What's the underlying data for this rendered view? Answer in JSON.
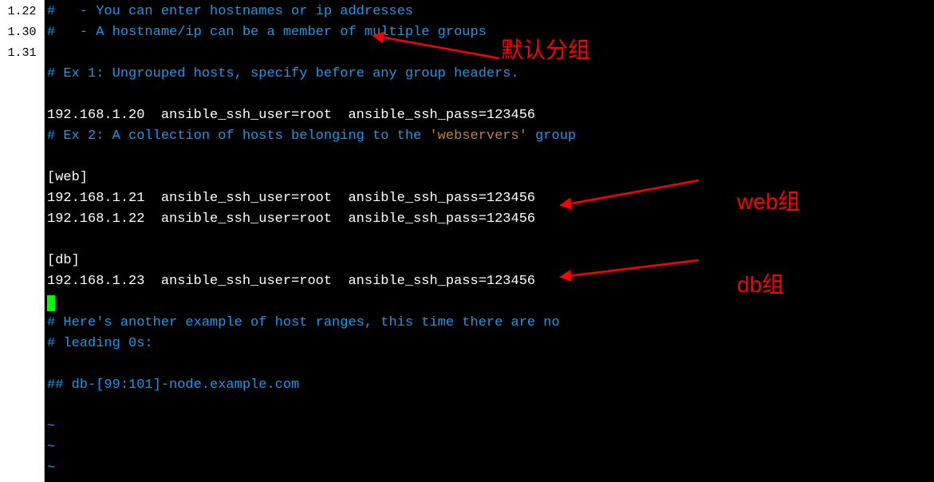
{
  "sidebar": {
    "items": [
      "1.22",
      "",
      "1.30",
      "1.31"
    ]
  },
  "terminal": {
    "lines": [
      {
        "type": "comment",
        "text": "#   - You can enter hostnames or ip addresses"
      },
      {
        "type": "comment",
        "text": "#   - A hostname/ip can be a member of multiple groups"
      },
      {
        "type": "blank",
        "text": ""
      },
      {
        "type": "comment",
        "text": "# Ex 1: Ungrouped hosts, specify before any group headers."
      },
      {
        "type": "blank",
        "text": ""
      },
      {
        "type": "plain",
        "text": "192.168.1.20  ansible_ssh_user=root  ansible_ssh_pass=123456"
      },
      {
        "type": "comment_mixed",
        "text": "# Ex 2: A collection of hosts belonging to the 'webservers' group"
      },
      {
        "type": "blank",
        "text": ""
      },
      {
        "type": "plain",
        "text": "[web]"
      },
      {
        "type": "plain",
        "text": "192.168.1.21  ansible_ssh_user=root  ansible_ssh_pass=123456"
      },
      {
        "type": "plain",
        "text": "192.168.1.22  ansible_ssh_user=root  ansible_ssh_pass=123456"
      },
      {
        "type": "blank",
        "text": ""
      },
      {
        "type": "plain",
        "text": "[db]"
      },
      {
        "type": "plain",
        "text": "192.168.1.23  ansible_ssh_user=root  ansible_ssh_pass=123456"
      },
      {
        "type": "cursor",
        "text": ""
      },
      {
        "type": "comment",
        "text": "# Here's another example of host ranges, this time there are no"
      },
      {
        "type": "comment",
        "text": "# leading 0s:"
      },
      {
        "type": "blank",
        "text": ""
      },
      {
        "type": "comment",
        "text": "## db-[99:101]-node.example.com"
      },
      {
        "type": "blank",
        "text": ""
      },
      {
        "type": "tilde",
        "text": "~"
      },
      {
        "type": "tilde",
        "text": "~"
      },
      {
        "type": "tilde",
        "text": "~"
      }
    ]
  },
  "annotations": {
    "default_group": "默认分组",
    "web_group": "web组",
    "db_group": "db组"
  }
}
